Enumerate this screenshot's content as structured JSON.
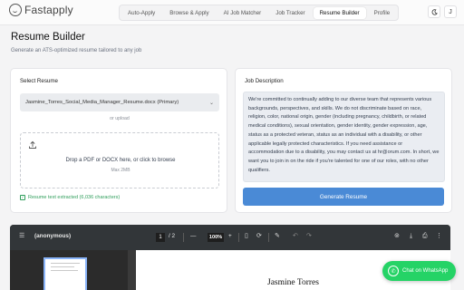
{
  "brand": {
    "name": "Fastapply"
  },
  "nav": {
    "tabs": [
      {
        "label": "Auto-Apply"
      },
      {
        "label": "Browse & Apply"
      },
      {
        "label": "AI Job Matcher"
      },
      {
        "label": "Job Tracker"
      },
      {
        "label": "Resume Builder",
        "active": true
      },
      {
        "label": "Profile"
      }
    ]
  },
  "header": {
    "theme_toggle_icon": "moon-icon",
    "avatar_initial": "J"
  },
  "page": {
    "title": "Resume Builder",
    "subtitle": "Generate an ATS-optimized resume tailored to any job"
  },
  "select_resume": {
    "label": "Select Resume",
    "selected": "Jasmine_Torres_Social_Media_Manager_Resume.docx (Primary)",
    "or_upload": "or upload",
    "dropzone_text": "Drop a PDF or DOCX here, or click to browse",
    "dropzone_max": "Max 2MB",
    "extracted_text": "Resume text extracted (6,036 characters)"
  },
  "job_description": {
    "label": "Job Description",
    "text": "We're committed to continually adding to our diverse team that represents various backgrounds, perspectives, and skills. We do not discriminate based on race, religion, color, national origin, gender (including pregnancy, childbirth, or related medical conditions), sexual orientation, gender identity, gender expression, age, status as a protected veteran, status as an individual with a disability, or other applicable legally protected characteristics. If you need assistance or accommodation due to a disability, you may contact us at hr@orum.com. In short, we want you to join in on the ride if you're talented for one of our roles, with no other qualifiers.",
    "button": "Generate Resume"
  },
  "viewer": {
    "filename": "(anonymous)",
    "page_current": "1",
    "page_total": "/ 2",
    "zoom": "100%",
    "minus": "—",
    "plus": "+",
    "document_name": "Jasmine Torres"
  },
  "whatsapp": {
    "label": "Chat on WhatsApp"
  },
  "colors": {
    "primary_button": "#4a8ad6",
    "success": "#2f9e5b",
    "whatsapp": "#25d366",
    "viewer_toolbar": "#323639"
  }
}
